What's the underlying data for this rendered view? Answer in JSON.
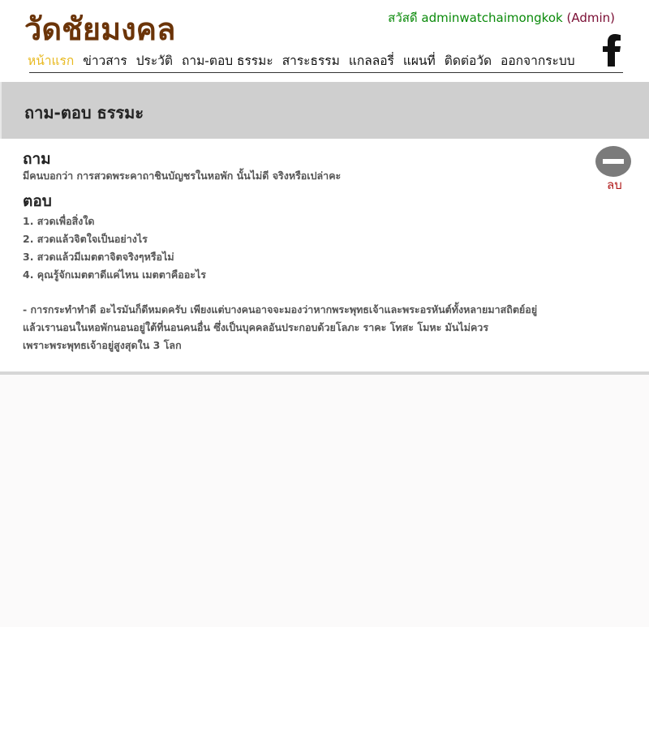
{
  "site": {
    "logo": "วัดชัยมงคล",
    "greeting_prefix": "สวัสดี adminwatchaimongkok",
    "greeting_role": "(Admin)",
    "facebook_icon": "facebook-icon"
  },
  "nav": {
    "items": [
      {
        "label": "หน้าแรก",
        "active": true
      },
      {
        "label": "ข่าวสาร"
      },
      {
        "label": "ประวัติ"
      },
      {
        "label": "ถาม-ตอบ ธรรมะ"
      },
      {
        "label": "สาระธรรม"
      },
      {
        "label": "แกลลอรี่"
      },
      {
        "label": "แผนที่"
      },
      {
        "label": "ติดต่อวัด"
      },
      {
        "label": "ออกจากระบบ"
      }
    ]
  },
  "page": {
    "title": "ถาม-ตอบ ธรรมะ"
  },
  "qa": {
    "question_label": "ถาม",
    "question_text": "มีคนบอกว่า การสวดพระคาถาชินบัญชรในหอพัก นั้นไม่ดี จริงหรือเปล่าคะ",
    "answer_label": "ตอบ",
    "answer_items": [
      "1. สวดเพื่อสิ่งใด",
      "2. สวดแล้วจิตใจเป็นอย่างไร",
      "3. สวดแล้วมีเมตตาจิตจริงๆหรือไม่",
      "4. คุณรู้จักเมตตาดีแค่ไหน เมตตาคืออะไร"
    ],
    "answer_paragraph": [
      "- การกระทำทำดี อะไรมันก็ดีหมดครับ เพียงแต่บางคนอาจจะมองว่าหากพระพุทธเจ้าและพระอรหันต์ทั้งหลายมาสถิตย์อยู่",
      "แล้วเรานอนในหอพักนอนอยู่ใต้ที่นอนคนอื่น ซึ่งเป็นบุคคลอันประกอบด้วยโลภะ ราคะ โทสะ โมหะ มันไม่ควร",
      "เพราะพระพุทธเจ้าอยู่สูงสุดใน 3 โลก"
    ],
    "delete_label": "ลบ",
    "delete_icon": "minus-circle-icon"
  },
  "colors": {
    "logo": "#6b3408",
    "active_nav": "#e8b920",
    "greeting": "#0a8a0a",
    "role": "#7a0d33",
    "delete": "#b01818",
    "title_band": "#cfcfcf"
  }
}
